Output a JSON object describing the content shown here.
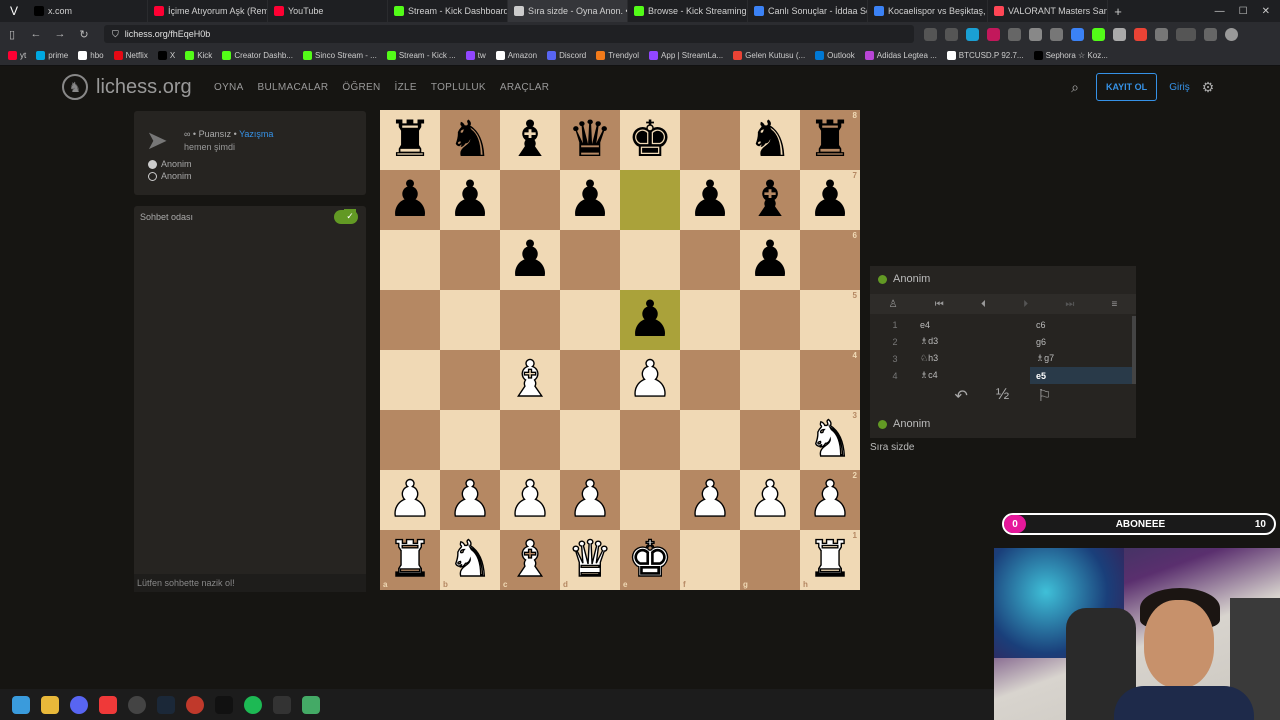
{
  "browser": {
    "tabs": [
      {
        "label": "x.com",
        "color": "#000000"
      },
      {
        "label": "İçime Atıyorum Aşk (Remix",
        "color": "#ff0033"
      },
      {
        "label": "YouTube",
        "color": "#ff0033"
      },
      {
        "label": "Stream - Kick Dashboard",
        "color": "#53fc18"
      },
      {
        "label": "Sıra sizde - Oyna Anon. • li",
        "color": "#cccccc",
        "active": true
      },
      {
        "label": "Browse - Kick Streaming",
        "color": "#53fc18"
      },
      {
        "label": "Canlı Sonuçlar - İddaa Son",
        "color": "#3b82f6"
      },
      {
        "label": "Kocaelispor vs Beşiktaş, İdd",
        "color": "#3b82f6"
      },
      {
        "label": "VALORANT Masters Santia",
        "color": "#ff4655"
      }
    ],
    "url": "lichess.org/fhEqeH0b",
    "bookmarks": [
      {
        "label": "yt",
        "color": "#ff0033"
      },
      {
        "label": "prime",
        "color": "#00a8e1"
      },
      {
        "label": "hbo",
        "color": "#ffffff"
      },
      {
        "label": "Netflix",
        "color": "#e50914"
      },
      {
        "label": "X",
        "color": "#000000"
      },
      {
        "label": "Kick",
        "color": "#53fc18"
      },
      {
        "label": "Creator Dashb...",
        "color": "#53fc18"
      },
      {
        "label": "Sinco Stream - ...",
        "color": "#53fc18"
      },
      {
        "label": "Stream - Kick ...",
        "color": "#53fc18"
      },
      {
        "label": "tw",
        "color": "#9146ff"
      },
      {
        "label": "Amazon",
        "color": "#ffffff"
      },
      {
        "label": "Discord",
        "color": "#5865f2"
      },
      {
        "label": "Trendyol",
        "color": "#f27a1a"
      },
      {
        "label": "App | StreamLa...",
        "color": "#9146ff"
      },
      {
        "label": "Gelen Kutusu (...",
        "color": "#ea4335"
      },
      {
        "label": "Outlook",
        "color": "#0078d4"
      },
      {
        "label": "Adidas Legtea ...",
        "color": "#b845d6"
      },
      {
        "label": "BTCUSD.P 92.7...",
        "color": "#ffffff"
      },
      {
        "label": "Sephora ☆ Koz...",
        "color": "#000000"
      }
    ]
  },
  "site": {
    "logo": "lichess.org",
    "nav": [
      "OYNA",
      "BULMACALAR",
      "ÖĞREN",
      "İZLE",
      "TOPLULUK",
      "ARAÇLAR"
    ],
    "signup": "KAYIT OL",
    "login": "Giriş"
  },
  "game_info": {
    "line1_prefix": "∞ • Puansız •",
    "line1_link": "Yazışma",
    "line2": "hemen şimdi",
    "players": [
      "Anonim",
      "Anonim"
    ]
  },
  "chat": {
    "title": "Sohbet odası",
    "placeholder": "Lütfen sohbette nazik ol!"
  },
  "board": {
    "files": [
      "a",
      "b",
      "c",
      "d",
      "e",
      "f",
      "g",
      "h"
    ],
    "ranks": [
      "8",
      "7",
      "6",
      "5",
      "4",
      "3",
      "2",
      "1"
    ],
    "rows": [
      [
        "bR",
        "bN",
        "bB",
        "bQ",
        "bK",
        "",
        "bN",
        "bR"
      ],
      [
        "bP",
        "bP",
        "",
        "bP",
        "",
        "bP",
        "bB",
        "bP"
      ],
      [
        "",
        "",
        "bP",
        "",
        "",
        "",
        "bP",
        ""
      ],
      [
        "",
        "",
        "",
        "",
        "bP",
        "",
        "",
        ""
      ],
      [
        "",
        "",
        "wB",
        "",
        "wP",
        "",
        "",
        ""
      ],
      [
        "",
        "",
        "",
        "",
        "",
        "",
        "",
        "wN"
      ],
      [
        "wP",
        "wP",
        "wP",
        "wP",
        "",
        "wP",
        "wP",
        "wP"
      ],
      [
        "wR",
        "wN",
        "wB",
        "wQ",
        "wK",
        "",
        "",
        "wR"
      ]
    ],
    "highlights": [
      "e7",
      "e5"
    ]
  },
  "move_panel": {
    "top_player": "Anonim",
    "bottom_player": "Anonim",
    "moves": [
      {
        "n": "1",
        "w": "e4",
        "b": "c6"
      },
      {
        "n": "2",
        "w": "♗d3",
        "b": "g6"
      },
      {
        "n": "3",
        "w": "♘h3",
        "b": "♗g7"
      },
      {
        "n": "4",
        "w": "♗c4",
        "b": "e5"
      }
    ],
    "draw": "½",
    "turn": "Sıra sizde"
  },
  "overlay": {
    "sub_current": "0",
    "sub_label": "ABONEEE",
    "sub_goal": "10",
    "sub_progress": 0
  }
}
